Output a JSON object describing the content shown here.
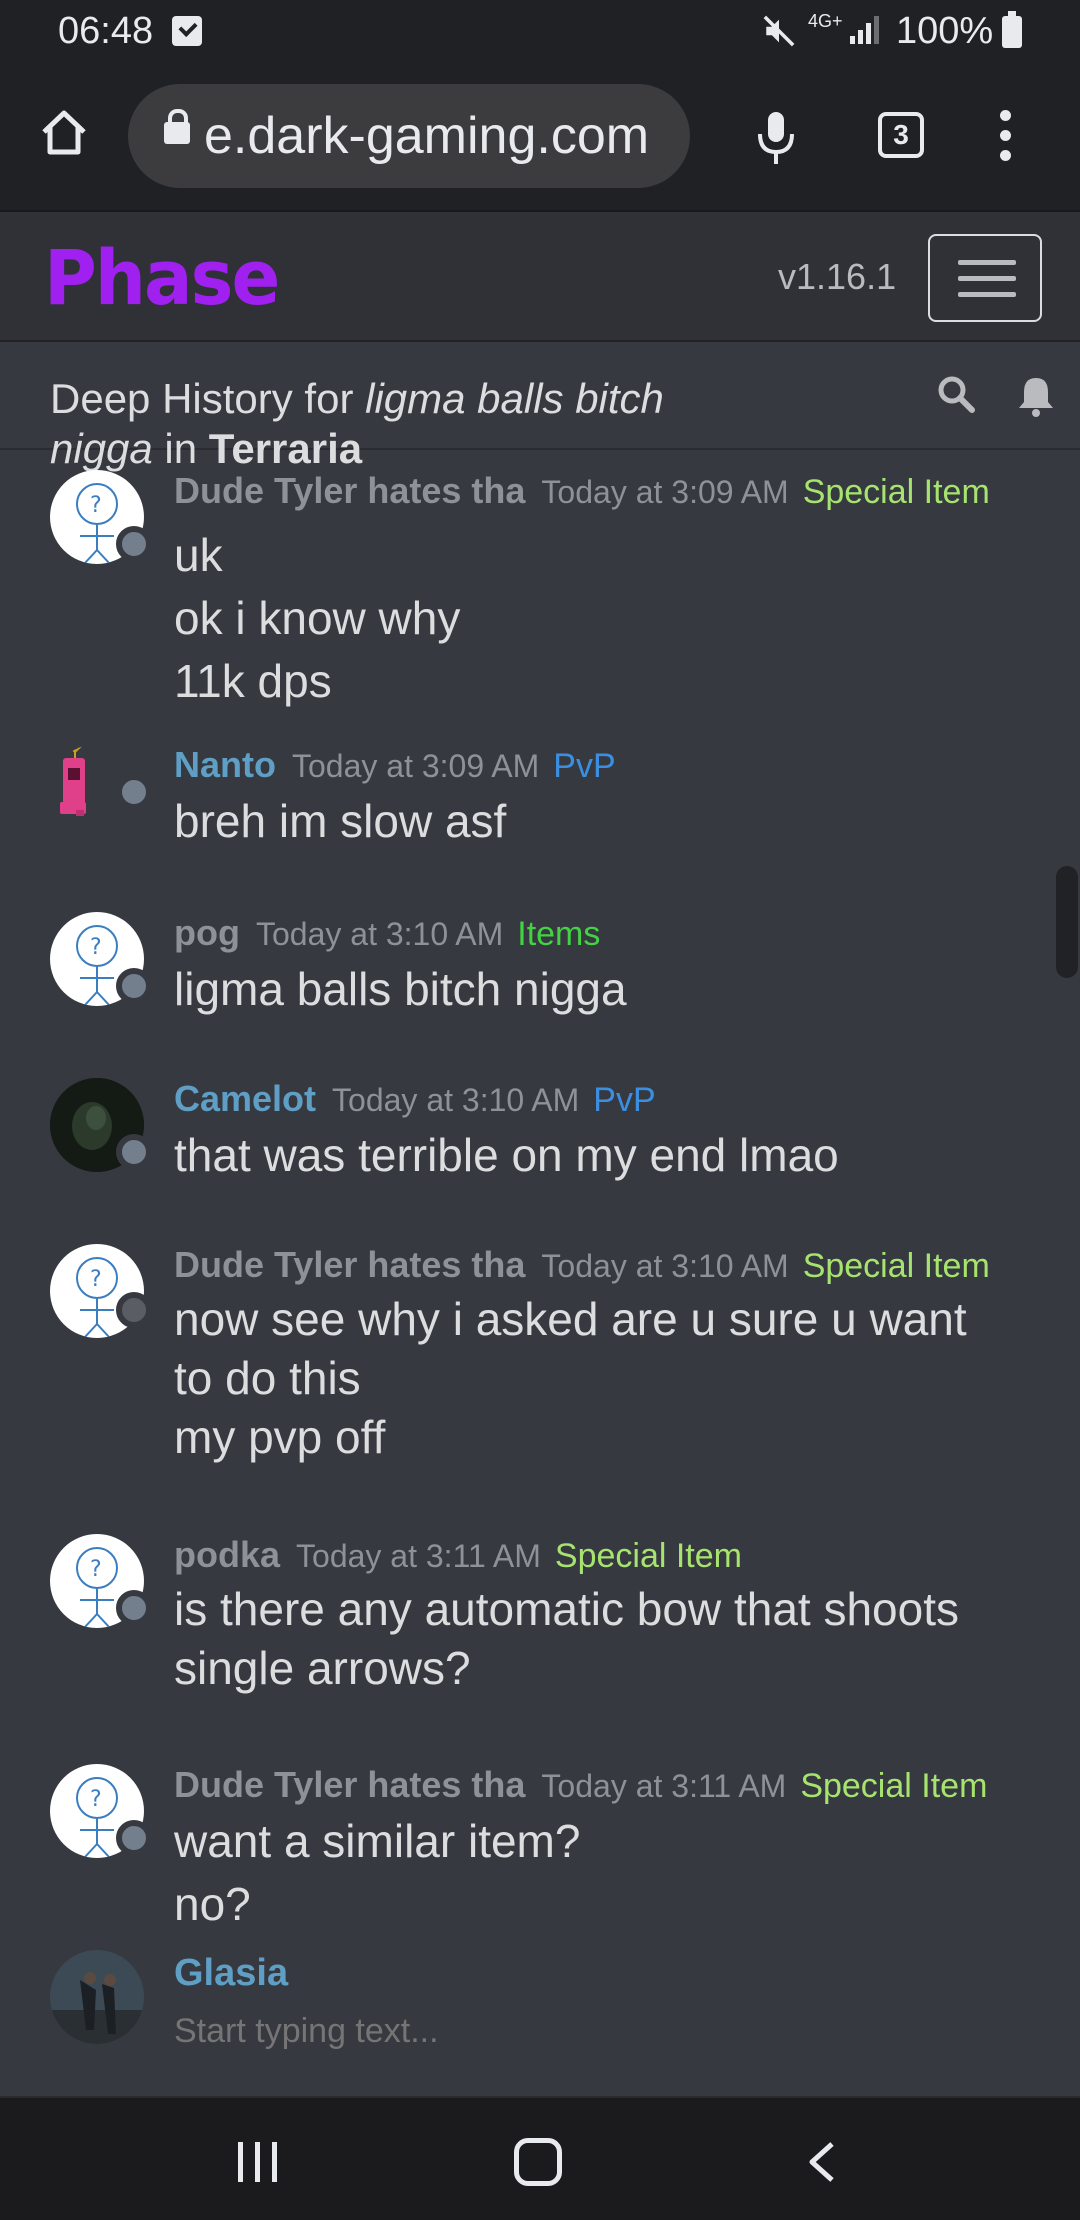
{
  "status_bar": {
    "time": "06:48",
    "network": "4G+",
    "battery": "100%"
  },
  "browser": {
    "url": "e.dark-gaming.com",
    "tab_count": "3"
  },
  "app": {
    "logo": "Phase",
    "version": "v1.16.1"
  },
  "channel": {
    "prefix": "Deep History for ",
    "user": "ligma balls bitch nigga",
    "mid": " in ",
    "game": "Terraria"
  },
  "messages": [
    {
      "author": "Dude Tyler hates tha",
      "time": "Today at 3:09 AM",
      "tag": "Special Item",
      "lines": [
        "uk",
        "ok i know why",
        "11k dps"
      ]
    },
    {
      "author": "Nanto",
      "time": "Today at 3:09 AM",
      "tag": "PvP",
      "lines": [
        "breh im slow asf"
      ]
    },
    {
      "author": "pog",
      "time": "Today at 3:10 AM",
      "tag": "Items",
      "lines": [
        "ligma balls bitch nigga"
      ]
    },
    {
      "author": "Camelot",
      "time": "Today at 3:10 AM",
      "tag": "PvP",
      "lines": [
        "that was terrible on my end lmao"
      ]
    },
    {
      "author": "Dude Tyler hates tha",
      "time": "Today at 3:10 AM",
      "tag": "Special Item",
      "lines": [
        "now see why i asked are u sure u want",
        "to do this",
        "my pvp off"
      ]
    },
    {
      "author": "podka",
      "time": "Today at 3:11 AM",
      "tag": "Special Item",
      "lines": [
        "is there any automatic bow that shoots",
        "single arrows?"
      ]
    },
    {
      "author": "Dude Tyler hates tha",
      "time": "Today at 3:11 AM",
      "tag": "Special Item",
      "lines": [
        "want a similar item?",
        "no?"
      ]
    }
  ],
  "composer": {
    "user": "Glasia",
    "placeholder": "Start typing text..."
  },
  "colors": {
    "accent_logo": "#a020f0",
    "special_item": "#a6e36f",
    "pvp": "#3b8fe0",
    "items": "#43d243",
    "username_blue": "#5f9fc6"
  },
  "icons": [
    "home-icon",
    "lock-icon",
    "mic-icon",
    "more-icon",
    "search-icon",
    "bell-icon",
    "recents-icon",
    "home-nav-icon",
    "back-icon"
  ]
}
